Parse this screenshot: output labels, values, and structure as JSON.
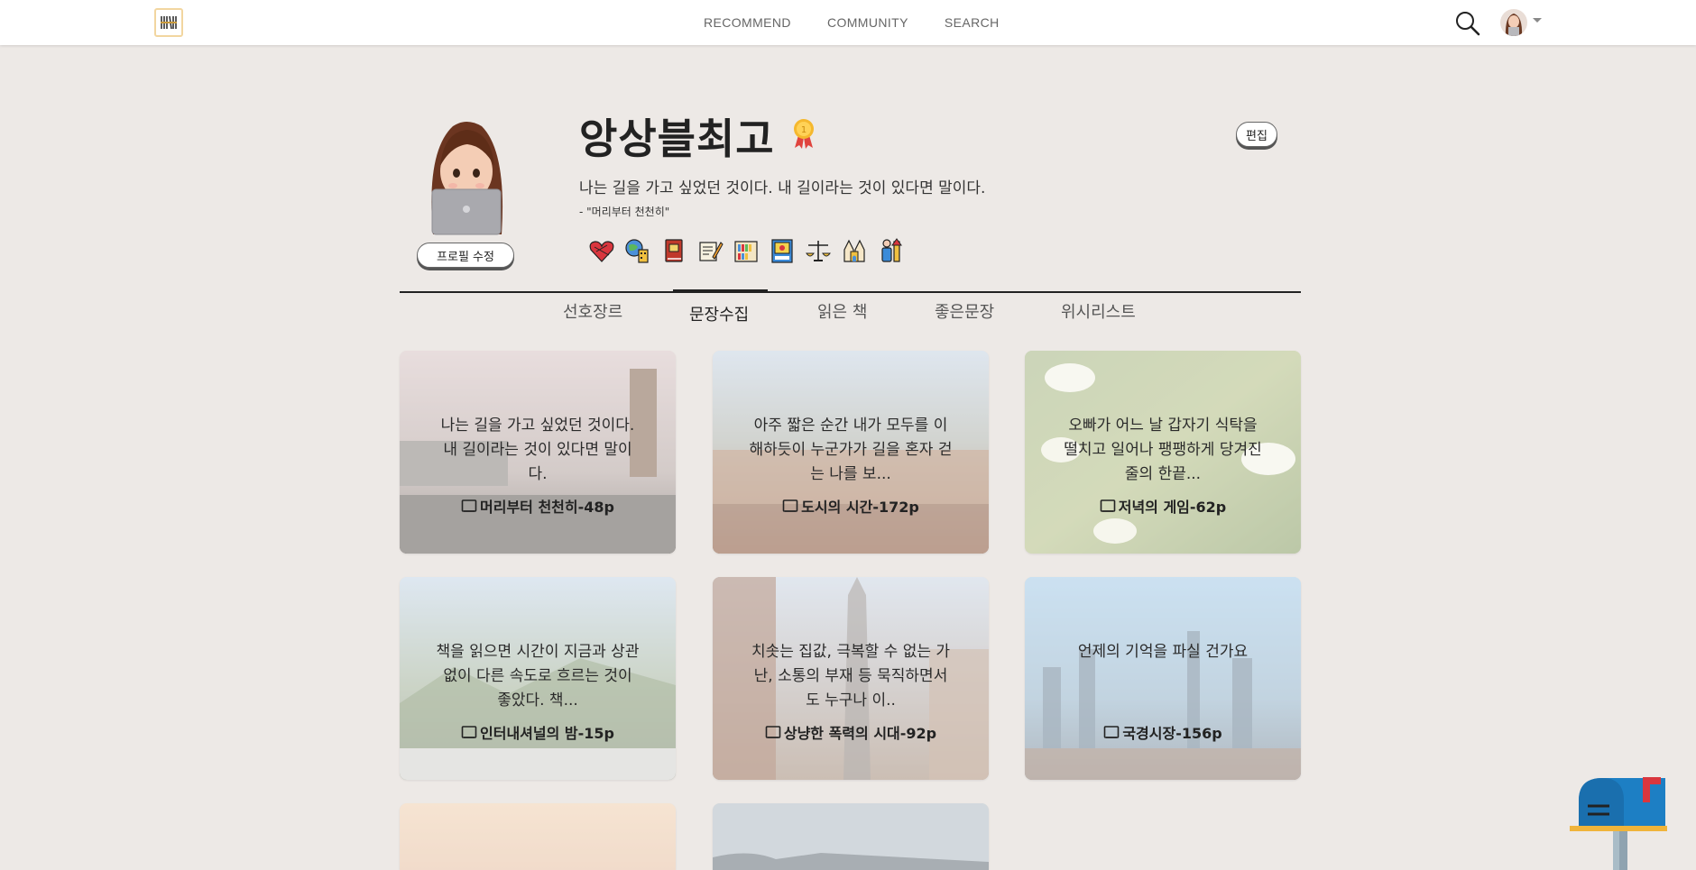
{
  "nav": {
    "links": [
      "RECOMMEND",
      "COMMUNITY",
      "SEARCH"
    ],
    "logo_icon": "bookshelf-logo-icon",
    "search_icon": "search-icon",
    "user_avatar_icon": "user-avatar-icon"
  },
  "profile": {
    "username": "앙상블최고",
    "bio": "나는 길을 가고 싶었던 것이다. 내 길이라는 것이 있다면 말이다.",
    "bio_source": "- \"머리부터 천천히\"",
    "profile_edit_label": "프로필 수정",
    "edit_label": "편집",
    "medal_icon": "medal-icon",
    "badges": [
      "heart-yarn-icon",
      "globe-city-icon",
      "book-icon",
      "writing-icon",
      "library-icon",
      "calendar-book-icon",
      "balance-icon",
      "cathedral-icon",
      "person-icon"
    ]
  },
  "tabs": [
    "선호장르",
    "문장수집",
    "읽은 책",
    "좋은문장",
    "위시리스트"
  ],
  "active_tab": "문장수집",
  "cards": [
    {
      "quote": "나는 길을 가고 싶었던 것이다. 내 길이라는 것이 있다면 말이다.",
      "book": "머리부터 천천히-48p"
    },
    {
      "quote": "아주 짧은 순간 내가 모두를 이해하듯이 누군가가 길을 혼자 걷는 나를 보...",
      "book": "도시의 시간-172p"
    },
    {
      "quote": "오빠가 어느 날 갑자기 식탁을 떨치고 일어나 팽팽하게 당겨진 줄의 한끝...",
      "book": "저녁의 게임-62p"
    },
    {
      "quote": "책을 읽으면 시간이 지금과 상관없이 다른 속도로 흐르는 것이 좋았다. 책...",
      "book": "인터내셔널의 밤-15p"
    },
    {
      "quote": "치솟는 집값, 극복할 수 없는 가난, 소통의 부재 등 묵직하면서도 누구나 이..",
      "book": "상냥한 폭력의 시대-92p"
    },
    {
      "quote": "언제의 기억을 파실 건가요",
      "book": "국경시장-156p"
    }
  ],
  "colors": {
    "background": "#ede9e6",
    "navbar": "#ffffff",
    "text": "#222222"
  }
}
